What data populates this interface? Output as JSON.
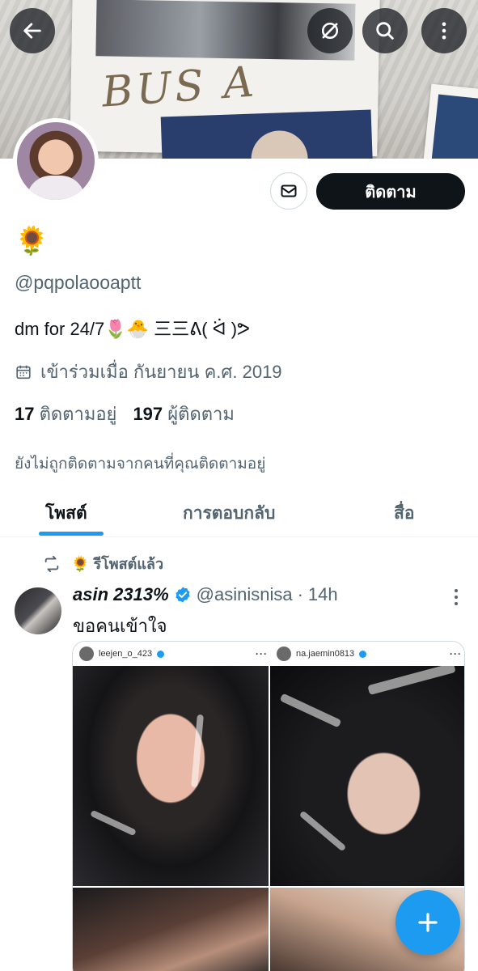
{
  "banner": {
    "scribble_text": "BUS A"
  },
  "header": {
    "back_icon": "arrow-left-icon",
    "translate_icon": "translate-off-icon",
    "search_icon": "search-icon",
    "more_icon": "more-vertical-icon"
  },
  "profile": {
    "display_name": "🌻",
    "handle": "@pqpolaooaptt",
    "bio": "dm for 24/7🌷🐣  三三ᕕ( ᐛ )ᕗ",
    "joined": "เข้าร่วมเมื่อ กันยายน ค.ศ. 2019",
    "following_count": "17",
    "following_label": "ติดตามอยู่",
    "followers_count": "197",
    "followers_label": "ผู้ติดตาม",
    "not_followed_note": "ยังไม่ถูกติดตามจากคนที่คุณติดตามอยู่",
    "follow_button": "ติดตาม"
  },
  "tabs": [
    {
      "label": "โพสต์",
      "active": true
    },
    {
      "label": "การตอบกลับ",
      "active": false
    },
    {
      "label": "สื่อ",
      "active": false
    }
  ],
  "post": {
    "repost_emoji": "🌻",
    "repost_label": "รีโพสต์แล้ว",
    "author_name": "asin 2313%",
    "author_handle": "@asinisnisa",
    "separator": "·",
    "time": "14h",
    "text": "ขอคนเข้าใจ",
    "media_users": [
      "leejen_o_423",
      "na.jaemin0813"
    ],
    "media_dots": "···"
  },
  "colors": {
    "accent": "#1d9bf0",
    "text": "#0f1419",
    "muted": "#536471"
  }
}
